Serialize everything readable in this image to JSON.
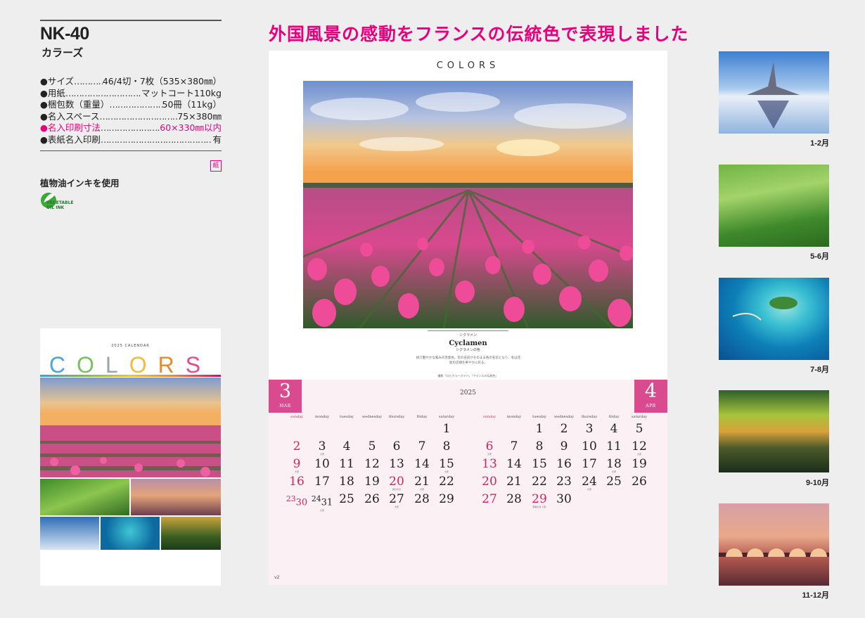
{
  "product": {
    "code": "NK-40",
    "name": "カラーズ",
    "specs": [
      {
        "label": "●サイズ",
        "value": "46/4切・7枚（535×380㎜）",
        "highlight": false
      },
      {
        "label": "●用紙",
        "value": "マットコート110kg",
        "highlight": false
      },
      {
        "label": "●梱包数（重量）",
        "value": "50冊（11kg）",
        "highlight": false
      },
      {
        "label": "●名入スペース",
        "value": "75×380㎜",
        "highlight": false
      },
      {
        "label": "●名入印刷寸法",
        "value": "60×330㎜以内",
        "highlight": true
      },
      {
        "label": "●表紙名入印刷",
        "value": "有",
        "highlight": false
      }
    ],
    "stamp": "紙",
    "ink_note": "植物油インキを使用",
    "vegetable_mark": [
      "VEGETABLE",
      "OIL INK"
    ]
  },
  "headline": "外国風景の感動をフランスの伝統色で表現しました",
  "cover": {
    "small_title": "2025 CALENDAR",
    "logo": "COLORS"
  },
  "calendar": {
    "title": "COLORS",
    "caption": {
      "ja_title": "シクラメン",
      "en_title": "Cyclamen",
      "ja_sub": "シクラメンの色",
      "body": "桃で艶やかな紫みの赤紫色。花の名前がそのまま色の名前となり、冬は花屋の店頭を華やかに彩る。",
      "credit": "撮影「ロビカラーガイド」「フランスの伝統色」"
    },
    "year": "2025",
    "page_number": "v2",
    "left_month": {
      "number": "3",
      "abbr": "MAR"
    },
    "right_month": {
      "number": "4",
      "abbr": "APR"
    },
    "weekdays": [
      "sunday",
      "monday",
      "tuesday",
      "wednesday",
      "thursday",
      "friday",
      "saturday"
    ]
  },
  "months_thumbnails": [
    {
      "label": "1-2月"
    },
    {
      "label": "5-6月"
    },
    {
      "label": "7-8月"
    },
    {
      "label": "9-10月"
    },
    {
      "label": "11-12月"
    }
  ],
  "colors": {
    "accent": "#e6007e",
    "month_tab": "#d94b8e",
    "sunday": "#d0245d",
    "grid_bg": "#fbf1f5"
  }
}
